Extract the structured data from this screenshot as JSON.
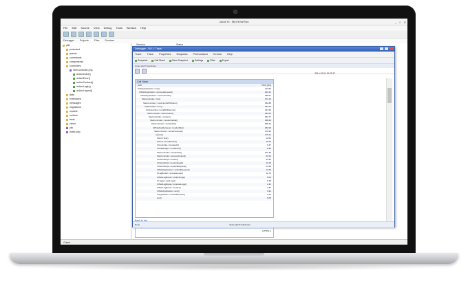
{
  "main_window": {
    "title": "Jacot Yii - MyYiiOneTwo",
    "menu": [
      "File",
      "Edit",
      "Source",
      "View",
      "Debug",
      "Tools",
      "Window",
      "Help"
    ],
    "tabs": [
      "Debugger",
      "Projects",
      "Files",
      "Services"
    ],
    "tree": [
      {
        "label": "yii6",
        "icon": "folder-icon",
        "indent": 0
      },
      {
        "label": "protected",
        "icon": "folder-icon",
        "indent": 1
      },
      {
        "label": "assets",
        "icon": "folder-icon",
        "indent": 1
      },
      {
        "label": "commands",
        "icon": "folder-icon",
        "indent": 1
      },
      {
        "label": "components",
        "icon": "folder-icon",
        "indent": 1
      },
      {
        "label": "controllers",
        "icon": "folder-icon",
        "indent": 1
      },
      {
        "label": "SiteController.php",
        "icon": "php-file-icon",
        "indent": 2
      },
      {
        "label": "actionIndex()",
        "icon": "method-icon",
        "indent": 3
      },
      {
        "label": "actionError()",
        "icon": "method-icon",
        "indent": 3
      },
      {
        "label": "actionContact()",
        "icon": "method-icon",
        "indent": 3
      },
      {
        "label": "actionLogin()",
        "icon": "method-icon",
        "indent": 3
      },
      {
        "label": "actionLogout()",
        "icon": "method-icon",
        "indent": 3
      },
      {
        "label": "data",
        "icon": "folder-icon",
        "indent": 1
      },
      {
        "label": "extensions",
        "icon": "folder-icon",
        "indent": 1
      },
      {
        "label": "messages",
        "icon": "folder-icon",
        "indent": 1
      },
      {
        "label": "migrations",
        "icon": "folder-icon",
        "indent": 1
      },
      {
        "label": "models",
        "icon": "folder-icon",
        "indent": 1
      },
      {
        "label": "runtime",
        "icon": "folder-icon",
        "indent": 1
      },
      {
        "label": "tests",
        "icon": "folder-icon",
        "indent": 1
      },
      {
        "label": "views",
        "icon": "folder-icon",
        "indent": 1
      },
      {
        "label": "yiic",
        "icon": "php-file-icon",
        "indent": 1
      },
      {
        "label": "index.php",
        "icon": "php-file-icon",
        "indent": 1
      }
    ],
    "props_header": [
      "Session",
      "Status"
    ],
    "status_text": "Output"
  },
  "trace": {
    "title": "Debugger - Yii 1.1 Trace",
    "menu": [
      "Trace",
      "Trace",
      "Properties",
      "Requests",
      "Performance",
      "Events",
      "Help"
    ],
    "toolbar": [
      "Snapshot",
      "Call Stack",
      "Clear Snapshot",
      "Settings",
      "Filter",
      "Export"
    ],
    "address": "/index.php?r=site/index",
    "time": "2014-12-01 10:23:17",
    "panel_title": "Call Stack",
    "col_left": "Call",
    "col_right": "Time (ms)",
    "rows": [
      {
        "label": "CWebApplication->run()",
        "value": "413.60"
      },
      {
        "label": "CWebApplication->processRequest()",
        "value": "401.21"
      },
      {
        "label": "CWebApplication->runController()",
        "value": "398.47"
      },
      {
        "label": "SiteController->run()",
        "value": "371.15"
      },
      {
        "label": "SiteController->runActionWithFilters()",
        "value": "352.88"
      },
      {
        "label": "CFilterChain->run()",
        "value": "351.09"
      },
      {
        "label": "CInlineAction->runWithParams()",
        "value": "347.62"
      },
      {
        "label": "SiteController->actionIndex()",
        "value": "344.03"
      },
      {
        "label": "SiteController->render()",
        "value": "301.77"
      },
      {
        "label": "SiteController->renderPartial()",
        "value": "188.40"
      },
      {
        "label": "SiteController->renderFile()",
        "value": "185.12"
      },
      {
        "label": "CPhpViewRenderer->renderFile()",
        "value": "182.00"
      },
      {
        "label": "SiteController->renderInternal()",
        "value": "176.93"
      },
      {
        "label": "require()",
        "value": "175.11"
      },
      {
        "label": "CHtml::link()",
        "value": "12.54"
      },
      {
        "label": "CHtml::normalizeUrl()",
        "value": "10.02"
      },
      {
        "label": "CController->createUrl()",
        "value": "9.47"
      },
      {
        "label": "CUrlManager->createUrl()",
        "value": "8.90"
      },
      {
        "label": "SiteController->renderFile()",
        "value": "101.30"
      },
      {
        "label": "SiteController->processOutput()",
        "value": "63.12"
      },
      {
        "label": "CClientScript->render()",
        "value": "51.84"
      },
      {
        "label": "CClientScript->renderHead()",
        "value": "21.06"
      },
      {
        "label": "CClientScript->renderBodyEnd()",
        "value": "14.20"
      },
      {
        "label": "CWebApplication->onEndRequest()",
        "value": "12.39"
      },
      {
        "label": "CLogRouter->processLogs()",
        "value": "11.71"
      },
      {
        "label": "CWebLogRoute->collectLogs()",
        "value": "9.03"
      },
      {
        "label": "CLogger->getLogs()",
        "value": "6.48"
      },
      {
        "label": "CWebLogRoute->processLogs()",
        "value": "2.31"
      },
      {
        "label": "CWebLogRoute->render()",
        "value": "1.87"
      },
      {
        "label": "CWebApplication->end()",
        "value": "0.91"
      },
      {
        "label": "CApplication->onEndRequest()",
        "value": "0.44"
      },
      {
        "label": "exit()",
        "value": "0.05"
      }
    ],
    "link_text": "Back to top",
    "panel2_title": "Request Headers",
    "panel2_value": "HTTP/1.1",
    "status_left": "Done",
    "status_mid": "/index.php?r=site/index"
  }
}
